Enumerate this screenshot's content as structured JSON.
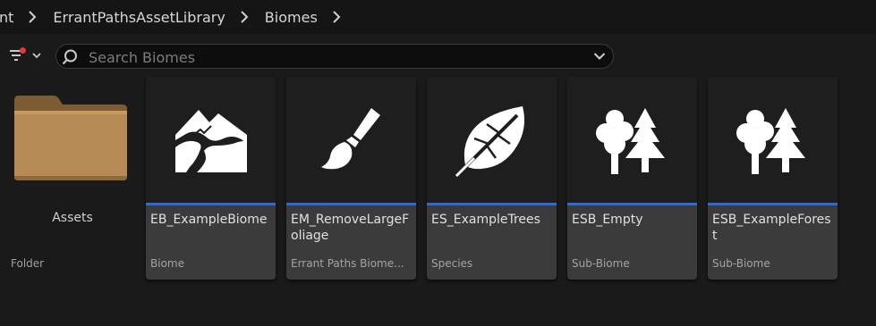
{
  "breadcrumb": {
    "items": [
      "nt",
      "ErrantPathsAssetLibrary",
      "Biomes"
    ]
  },
  "toolbar": {
    "filter_icon": "filter-icon",
    "search": {
      "placeholder": "Search Biomes",
      "value": ""
    }
  },
  "folders": [
    {
      "name": "Assets",
      "type": "Folder"
    }
  ],
  "assets": [
    {
      "name": "EB_ExampleBiome",
      "type": "Biome",
      "icon": "landscape-icon"
    },
    {
      "name": "EM_RemoveLargeFoliage",
      "type": "Errant Paths Biome...",
      "icon": "brush-icon"
    },
    {
      "name": "ES_ExampleTrees",
      "type": "Species",
      "icon": "leaf-icon"
    },
    {
      "name": "ESB_Empty",
      "type": "Sub-Biome",
      "icon": "trees-icon"
    },
    {
      "name": "ESB_ExampleForest",
      "type": "Sub-Biome",
      "icon": "trees-icon"
    }
  ],
  "colors": {
    "accent": "#2d6ad6",
    "filter_dot": "#e03a3a",
    "background": "#1a1a1a"
  }
}
